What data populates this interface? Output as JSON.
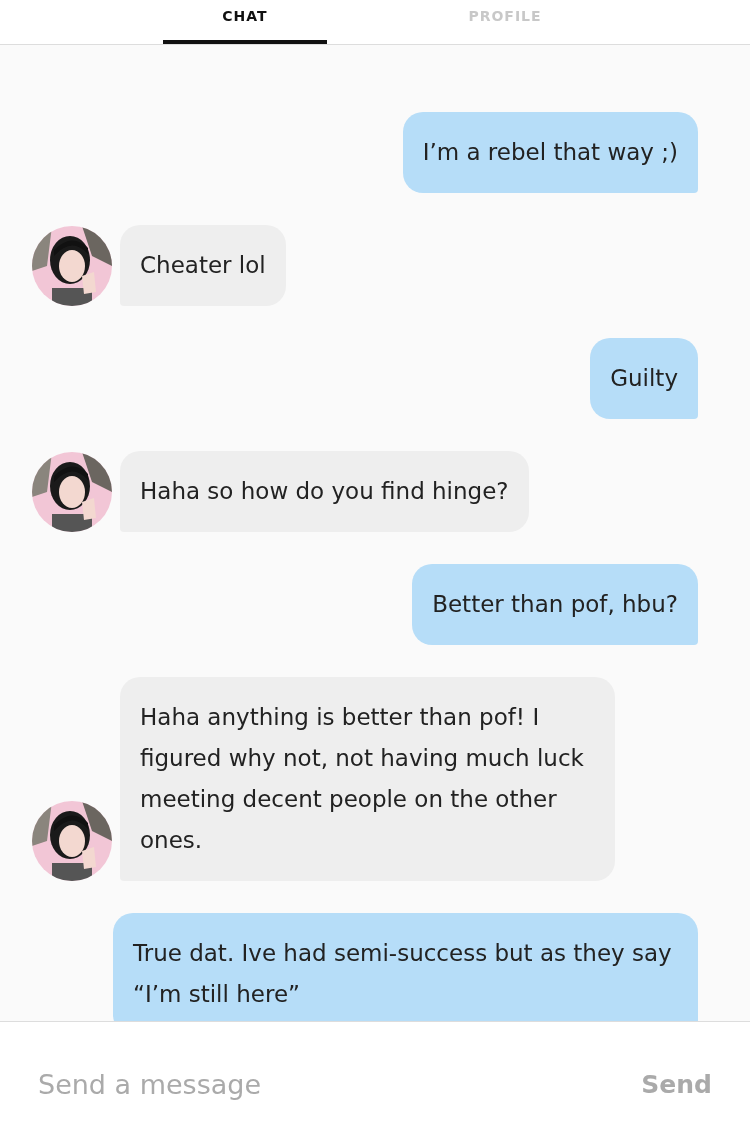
{
  "tabs": [
    {
      "label": "CHAT",
      "selected": true
    },
    {
      "label": "PROFILE",
      "selected": false
    }
  ],
  "messages": [
    {
      "kind": "outgoing",
      "text": "I’m a rebel that way ;)"
    },
    {
      "kind": "incoming",
      "text": "Cheater lol"
    },
    {
      "kind": "outgoing",
      "text": "Guilty"
    },
    {
      "kind": "incoming",
      "text": "Haha so how do you find hinge?"
    },
    {
      "kind": "outgoing",
      "text": "Better than pof, hbu?"
    },
    {
      "kind": "incoming",
      "text": "Haha anything is better than pof! I figured why not, not having much luck meeting decent people on the other ones."
    },
    {
      "kind": "outgoing",
      "text": "True dat. Ive had semi-success but as they say “I’m still here”"
    }
  ],
  "composer": {
    "placeholder": "Send a message",
    "send": "Send"
  }
}
